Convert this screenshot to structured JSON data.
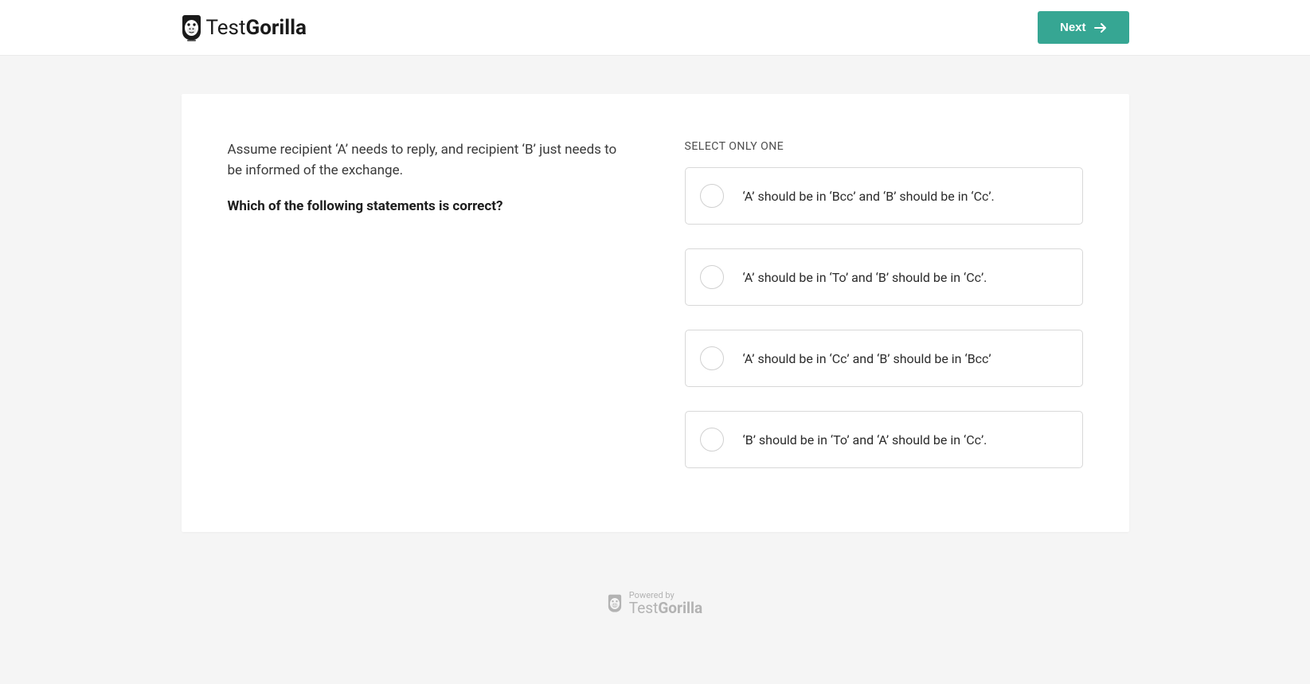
{
  "header": {
    "logo_light": "Test",
    "logo_bold": "Gorilla",
    "next_label": "Next"
  },
  "question": {
    "intro": "Assume recipient ‘A’ needs to reply, and recipient ‘B’ just needs to be informed of the exchange.",
    "prompt": "Which of the following statements is correct?",
    "select_label": "SELECT ONLY ONE",
    "options": [
      "‘A’ should be in ‘Bcc’ and ‘B’ should be in ‘Cc’.",
      "‘A’ should be in ‘To’ and ‘B’ should be in ‘Cc’.",
      "‘A’ should be in ‘Cc’ and ‘B’ should be in ‘Bcc’",
      "‘B’ should be in ‘To’ and ‘A’ should be in ‘Cc’."
    ]
  },
  "footer": {
    "powered": "Powered by",
    "brand_light": "Test",
    "brand_bold": "Gorilla"
  }
}
